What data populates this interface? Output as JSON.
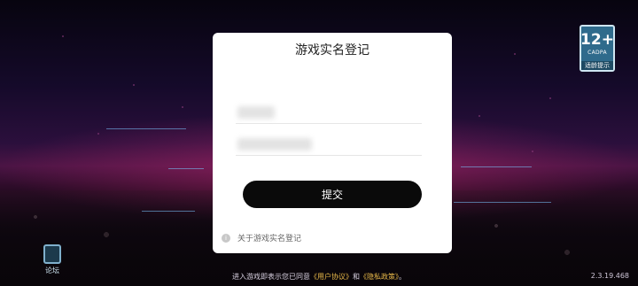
{
  "dialog": {
    "title": "游戏实名登记",
    "name_value": "",
    "id_value": "",
    "submit_label": "提交",
    "about_label": "关于游戏实名登记",
    "info_icon": "i"
  },
  "age_badge": {
    "age": "12+",
    "org": "CADPA",
    "tip": "适龄提示"
  },
  "forum": {
    "label": "论坛",
    "icon": "forum-icon"
  },
  "footer": {
    "prefix": "进入游戏即表示您已同意",
    "user_agreement": "《用户协议》",
    "and": "和",
    "privacy_policy": "《隐私政策》",
    "suffix": "。"
  },
  "version": "2.3.19.468"
}
